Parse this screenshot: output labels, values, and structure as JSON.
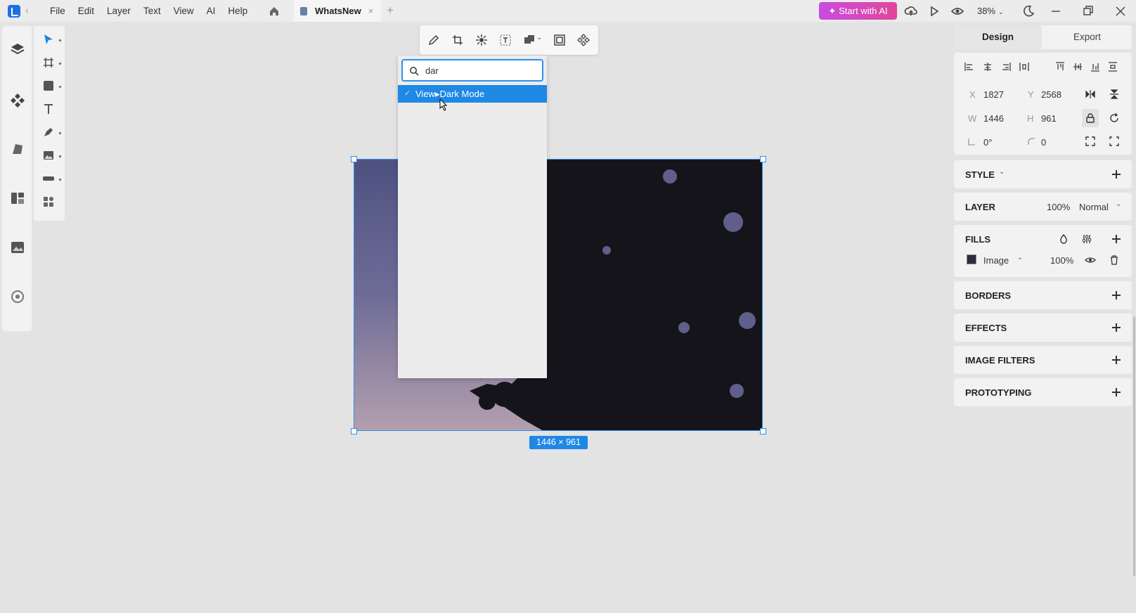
{
  "menu": {
    "items": [
      "File",
      "Edit",
      "Layer",
      "Text",
      "View",
      "AI",
      "Help"
    ]
  },
  "tab": {
    "title": "WhatsNew",
    "close": "×",
    "add": "+"
  },
  "toolbar_right": {
    "ai_button": "Start with AI",
    "zoom": "38%"
  },
  "search": {
    "query": "dar",
    "result": "View▸Dark Mode",
    "result_check": "✓"
  },
  "selection": {
    "size_label": "1446 × 961"
  },
  "right_panel": {
    "tabs": [
      "Design",
      "Export"
    ],
    "x_label": "X",
    "x_value": "1827",
    "y_label": "Y",
    "y_value": "2568",
    "w_label": "W",
    "w_value": "1446",
    "h_label": "H",
    "h_value": "961",
    "rotation_value": "0°",
    "radius_value": "0",
    "style_title": "STYLE",
    "layer_title": "LAYER",
    "layer_opacity": "100%",
    "layer_blend": "Normal",
    "fills_title": "FILLS",
    "fill_type": "Image",
    "fill_opacity": "100%",
    "borders_title": "BORDERS",
    "effects_title": "EFFECTS",
    "image_filters_title": "IMAGE FILTERS",
    "prototyping_title": "PROTOTYPING"
  },
  "colors": {
    "accent": "#1e88e5",
    "ai_button": "#d63fd6",
    "selection": "#2d8ff0"
  }
}
